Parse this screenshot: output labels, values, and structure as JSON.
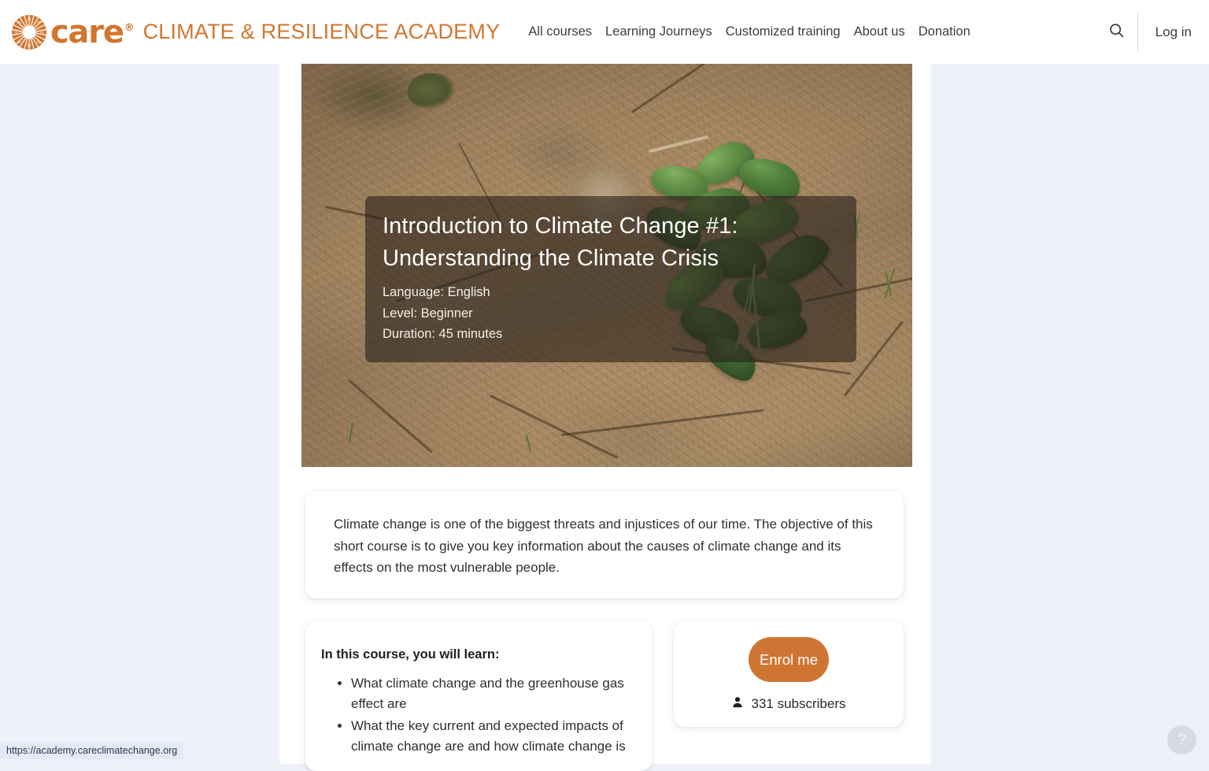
{
  "header": {
    "brand": {
      "logo_icon": "care-sunburst-logo",
      "care_text": "care",
      "registered_mark": "®",
      "academy_text": "CLIMATE & RESILIENCE ACADEMY",
      "accent_color": "#d2762f"
    },
    "nav": [
      {
        "label": "All courses"
      },
      {
        "label": "Learning Journeys"
      },
      {
        "label": "Customized training"
      },
      {
        "label": "About us"
      },
      {
        "label": "Donation"
      }
    ],
    "search_icon": "search-icon",
    "login_label": "Log in"
  },
  "hero": {
    "image_alt": "Green seedling growing in dry cracked soil",
    "title": "Introduction to Climate Change #1: Understanding the Climate Crisis",
    "meta": {
      "language": "Language: English",
      "level": "Level: Beginner",
      "duration": "Duration: 45 minutes"
    }
  },
  "description": {
    "text": "Climate change is one of the biggest threats and injustices of our time. The objective of this short course is to give you key information about the causes of climate change and its effects on the most vulnerable people."
  },
  "learn": {
    "heading": "In this course, you will learn:",
    "items": [
      "What climate change and the greenhouse gas effect are",
      "What the key current and expected impacts of climate change are and how climate change is"
    ]
  },
  "enrol": {
    "button_label": "Enrol me",
    "subscribers_icon": "person-icon",
    "subscribers_label": "331 subscribers",
    "button_color": "#cf7534"
  },
  "browser": {
    "status_url": "https://academy.careclimatechange.org"
  },
  "help": {
    "label": "?"
  }
}
